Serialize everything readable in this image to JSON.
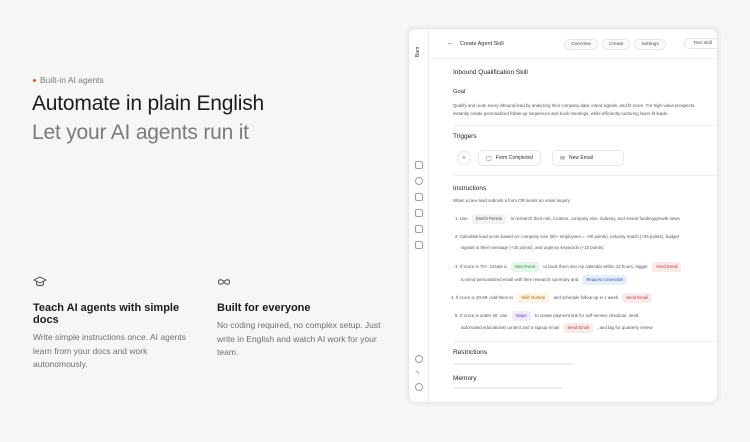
{
  "hero": {
    "eyebrow": "Built-in AI agents",
    "title_line1": "Automate in plain English",
    "title_line2": "Let your AI agents run it"
  },
  "features": [
    {
      "icon": "graduation-cap-icon",
      "title": "Teach AI agents with simple docs",
      "body": "Write simple instructions once. AI agents learn from your docs and work autonomously."
    },
    {
      "icon": "infinity-icon",
      "title": "Built for everyone",
      "body": "No coding required, no complex setup. Just write in English and watch AI work for your team."
    }
  ],
  "app": {
    "logo": "Bam",
    "breadcrumb": "Create Agent Skill",
    "tabs": [
      "Overview",
      "Create",
      "Settings"
    ],
    "test_button": "Test Skill",
    "skill_name": "Inbound Qualification Skill",
    "goal_label": "Goal",
    "goal_line1": "Qualify and route every inbound lead by analyzing their company data, intent signals, and fit score. For high-value prospects,",
    "goal_line2": "instantly create personalized follow-up sequences and book meetings, while efficiently nurturing lower-fit leads.",
    "triggers_label": "Triggers",
    "triggers": [
      "Form Completed",
      "New Email"
    ],
    "instructions_label": "Instructions",
    "instructions_intro": "When a new lead submits a form OR sends an email inquiry:",
    "steps": {
      "s1_pre": "1. Use",
      "s1_chip": "Enrich Person",
      "s1_post": "to research their role, location, company size, industry, and recent funding/growth news",
      "s2_line1": "2. Calculate lead score based on: company size (50+ employees = +30 points), industry match (+25 points), budget",
      "s2_line2": "signals in their message (+20 points), and urgency keywords (+15 points)",
      "s3_pre": "3. If score is 70+: Create a",
      "s3_chip": "New Event",
      "s3_mid": "to book them into my calendar within 24 hours, trigger",
      "s3_chip2": "Send Email",
      "s3_line2": "to send personalized email with their research summary and",
      "s3_chip3": "Request connection",
      "s4_pre": "4. If score is 40-69: Add them to",
      "s4_chip": "Skill: Nurture",
      "s4_mid": "and schedule follow-up in 1 week",
      "s4_chip2": "Send Email",
      "s5_pre": "5. If score is under 40: Use",
      "s5_chip": "Stripe",
      "s5_post": "to create payment link for self-service checkout, send",
      "s5_line2": "automated educational content and a signup email",
      "s5_chip2": "Send Email",
      "s5_post2": ", and tag for quarterly review"
    },
    "restrictions_label": "Restrictions",
    "memory_label": "Memory"
  }
}
